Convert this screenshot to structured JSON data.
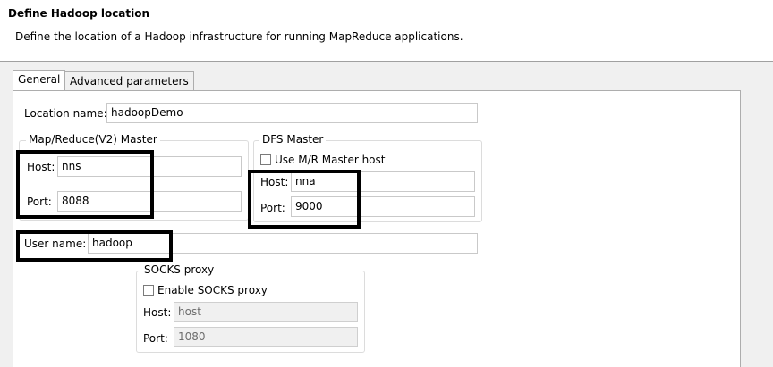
{
  "header": {
    "title": "Define Hadoop location",
    "description": "Define the location of a Hadoop infrastructure for running MapReduce applications."
  },
  "tabs": [
    {
      "label": "General",
      "active": true
    },
    {
      "label": "Advanced parameters",
      "active": false
    }
  ],
  "location": {
    "label": "Location name:",
    "value": "hadoopDemo"
  },
  "mr_master": {
    "title": "Map/Reduce(V2) Master",
    "host_label": "Host:",
    "host_value": "nns",
    "port_label": "Port:",
    "port_value": "8088"
  },
  "dfs_master": {
    "title": "DFS Master",
    "use_mr_label": "Use M/R Master host",
    "use_mr_checked": false,
    "host_label": "Host:",
    "host_value": "nna",
    "port_label": "Port:",
    "port_value": "9000"
  },
  "user": {
    "label": "User name:",
    "value": "hadoop"
  },
  "socks": {
    "title": "SOCKS proxy",
    "enable_label": "Enable SOCKS proxy",
    "enable_checked": false,
    "host_label": "Host:",
    "host_value": "host",
    "port_label": "Port:",
    "port_value": "1080"
  },
  "colors": {
    "highlight": "#000000",
    "panel_bg": "#f0f0f0"
  }
}
